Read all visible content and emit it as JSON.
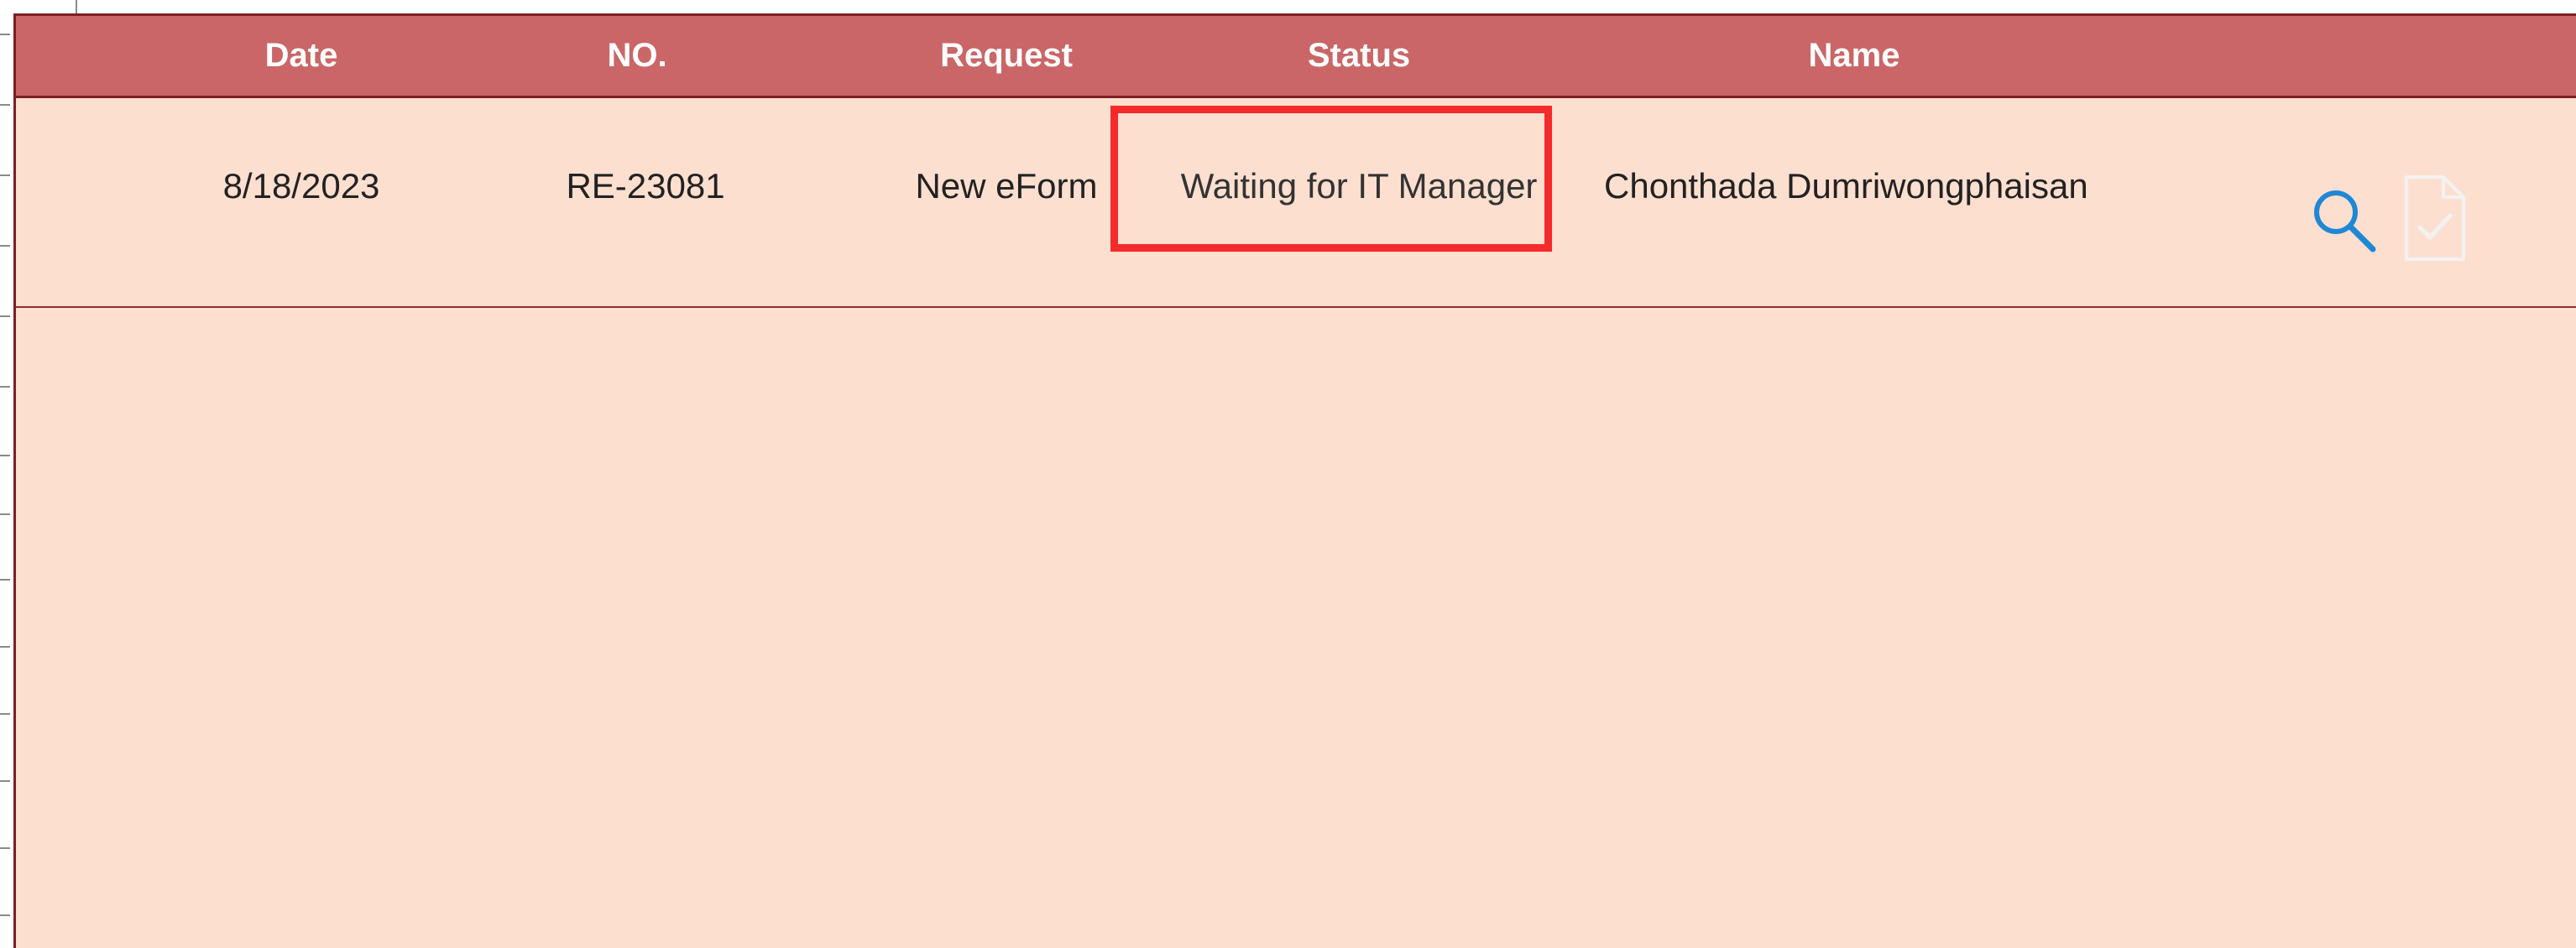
{
  "table": {
    "columns": [
      "Date",
      "NO.",
      "Request",
      "Status",
      "Name"
    ],
    "rows": [
      {
        "date": "8/18/2023",
        "no": "RE-23081",
        "request": "New eForm",
        "status": "Waiting for IT Manager",
        "name": "Chonthada Dumriwongphaisan"
      }
    ]
  },
  "actions": {
    "view_icon": "search-icon",
    "approve_icon": "document-check-icon"
  },
  "colors": {
    "header_bg": "#ca6667",
    "body_bg": "#fddfd0",
    "border": "#7a1e24",
    "highlight": "#f52a2a",
    "search_icon": "#1e88d6"
  }
}
